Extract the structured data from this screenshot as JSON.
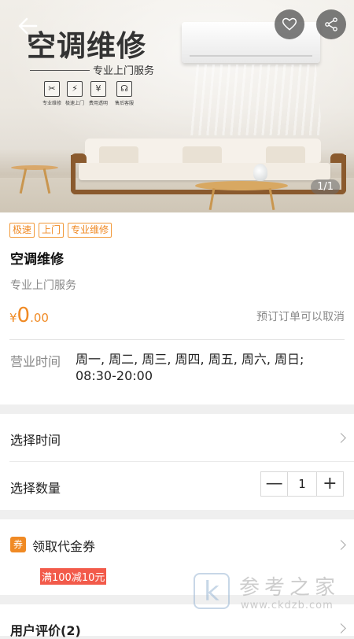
{
  "hero": {
    "title": "空调维修",
    "subtitle": "专业上门服务",
    "features": [
      {
        "icon": "tools-icon",
        "glyph": "✂",
        "label": "专业维修"
      },
      {
        "icon": "lightning-icon",
        "glyph": "⚡",
        "label": "极速上门"
      },
      {
        "icon": "yen-icon",
        "glyph": "¥",
        "label": "费用透明"
      },
      {
        "icon": "headset-icon",
        "glyph": "☊",
        "label": "售后客服"
      }
    ],
    "image_counter": "1/1"
  },
  "service": {
    "tags": [
      "极速",
      "上门",
      "专业维修"
    ],
    "title": "空调维修",
    "subtitle": "专业上门服务",
    "price_symbol": "¥",
    "price_int": "0",
    "price_dec": ".00",
    "cancel_note": "预订订单可以取消",
    "hours_label": "营业时间",
    "hours_value": "周一, 周二, 周三, 周四, 周五, 周六, 周日; 08:30-20:00"
  },
  "options": {
    "select_time": "选择时间",
    "select_qty": "选择数量",
    "qty_minus": "—",
    "qty_value": "1",
    "qty_plus": "+"
  },
  "coupon": {
    "badge": "券",
    "label": "领取代金券",
    "chip": "满100减10元"
  },
  "reviews": {
    "label": "用户评价(2)"
  },
  "watermark": {
    "logo": "k",
    "text": "参考之家",
    "url": "www.ckdzb.com"
  },
  "colors": {
    "accent": "#f08a24",
    "coupon_chip": "#f25a4a",
    "background": "#efefef"
  }
}
